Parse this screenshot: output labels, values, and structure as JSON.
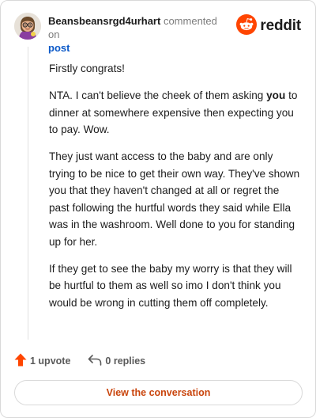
{
  "header": {
    "username": "Beansbeansrgd4urhart",
    "action_text": "commented on",
    "post_link": "post",
    "brand_name": "reddit"
  },
  "comment": {
    "paragraphs": [
      {
        "text": "Firstly congrats!"
      },
      {
        "before": "NTA. I can't believe the cheek of them asking ",
        "bold": "you",
        "after": " to dinner at somewhere expensive then expecting you to pay. Wow."
      },
      {
        "text": "They just want access to the baby and are only trying to be nice to get their own way. They've shown you that they haven't changed at all or regret the past following the hurtful words they said while Ella was in the washroom. Well done to you for standing up for her."
      },
      {
        "text": "If they get to see the baby my worry is that they will be hurtful to them as well so imo I don't think you would be wrong in cutting them off completely."
      }
    ]
  },
  "actions": {
    "upvotes": "1 upvote",
    "replies": "0 replies"
  },
  "cta": {
    "label": "View the conversation"
  },
  "icons": {
    "avatar": "avatar-icon",
    "brand": "reddit-logo-icon",
    "upvote": "upvote-arrow-icon",
    "reply": "reply-arrow-icon"
  },
  "colors": {
    "brand_orange": "#ff4500",
    "upvote": "#ff4500",
    "link_blue": "#0b59c8",
    "cta_text": "#c9450d"
  }
}
